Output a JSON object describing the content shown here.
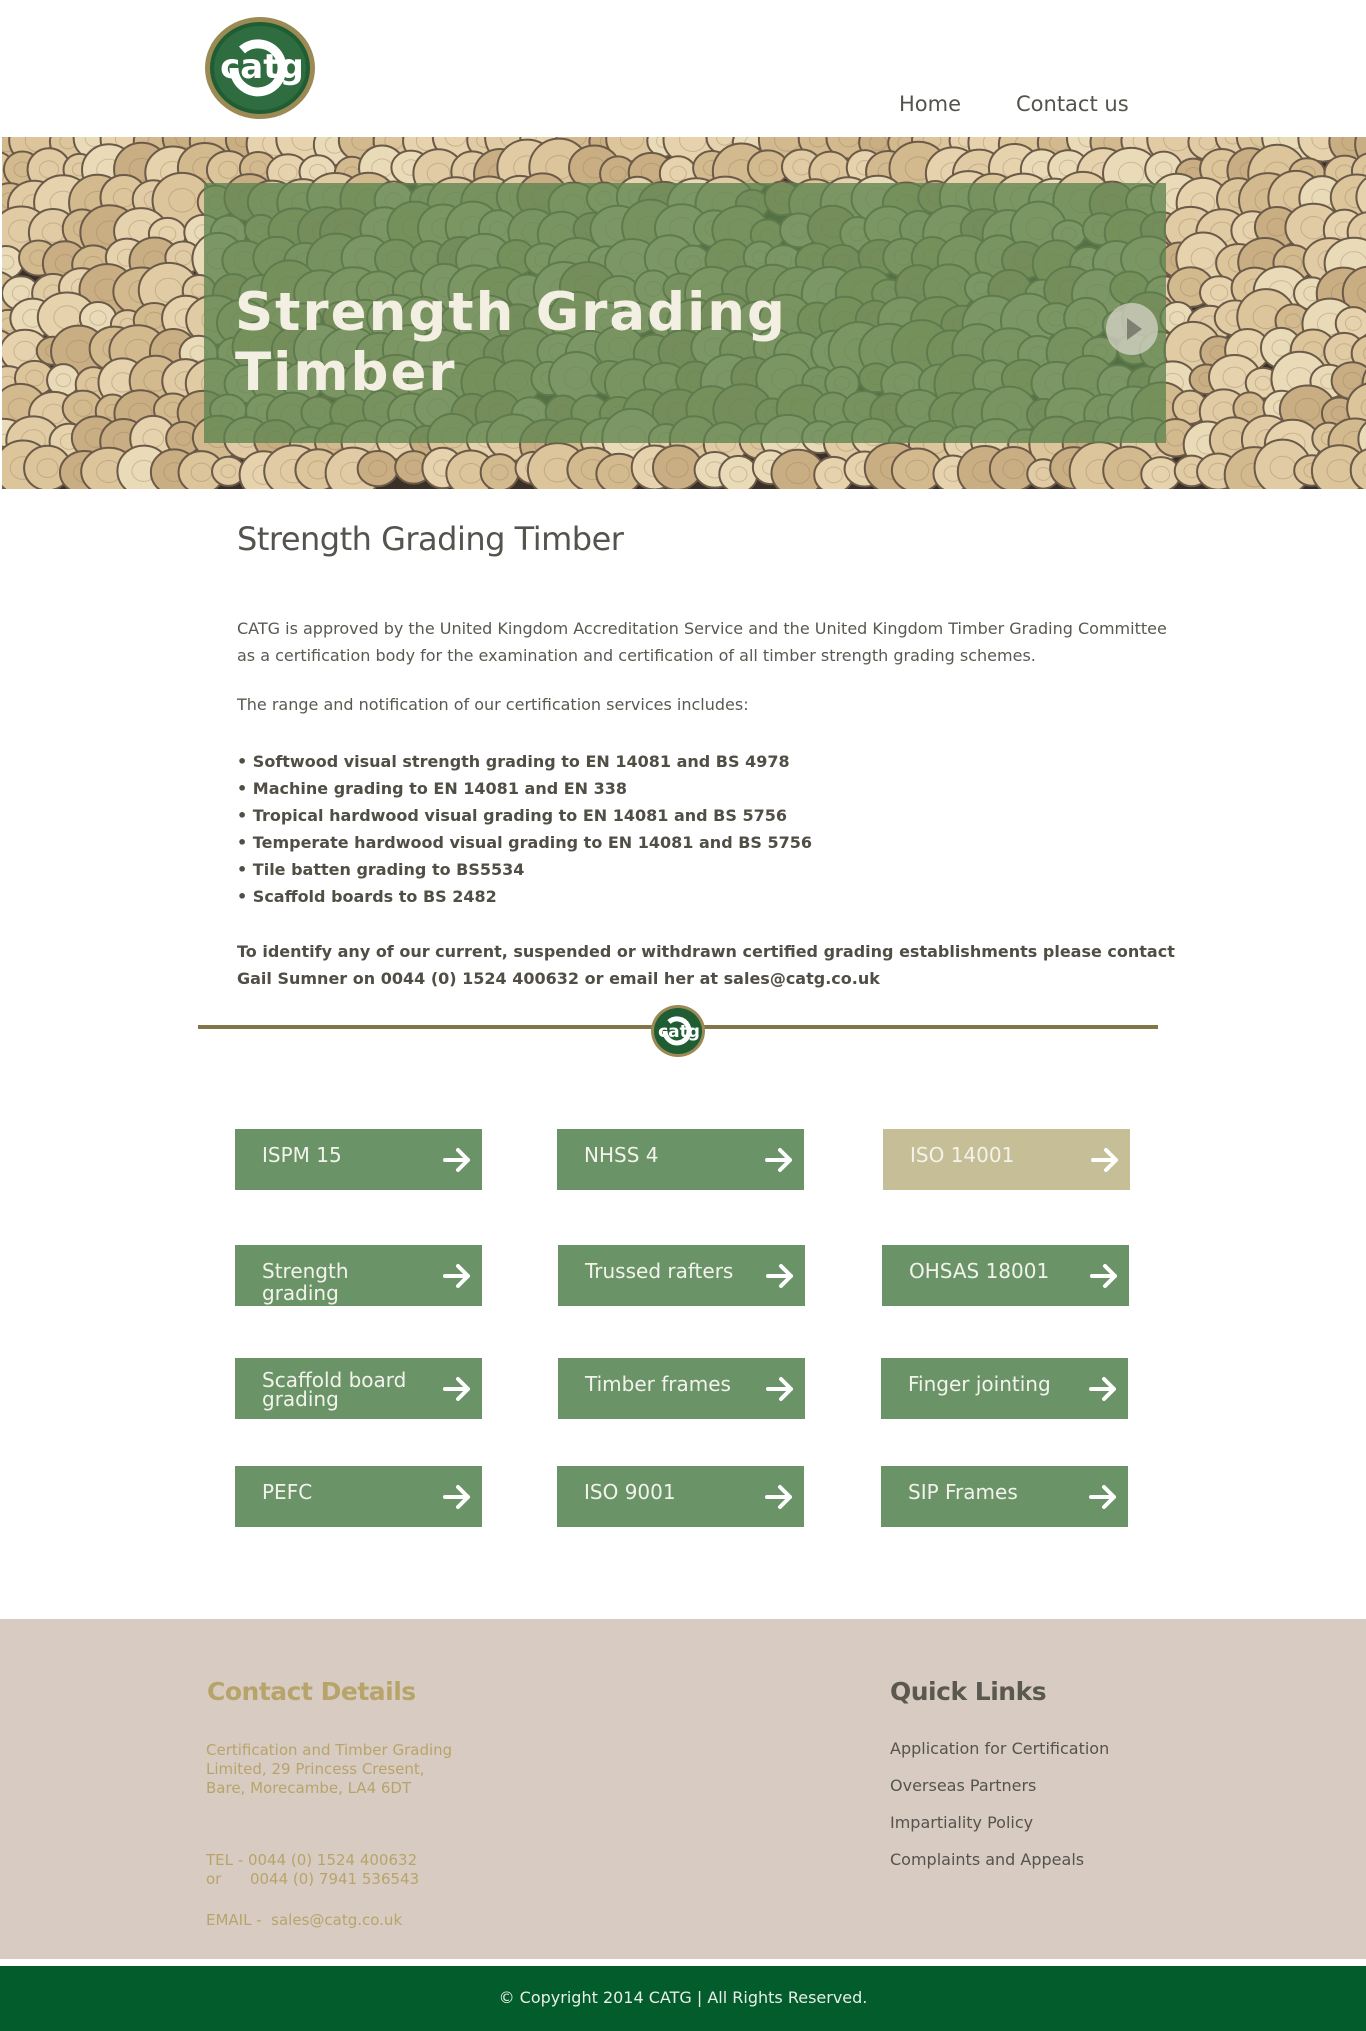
{
  "header": {
    "logo_text": "catg",
    "nav": {
      "home": "Home",
      "contact": "Contact us"
    }
  },
  "hero": {
    "title": "Strength Grading Timber"
  },
  "content": {
    "title": "Strength Grading Timber",
    "intro": "CATG is approved by the United Kingdom Accreditation Service and the United Kingdom Timber Grading Committee as a certification body for the examination and certification of all timber strength grading schemes.",
    "range": "The range and notification of our certification services includes:",
    "bullets": [
      "• Softwood visual strength grading to EN 14081 and BS 4978",
      "• Machine grading to EN 14081 and EN 338",
      "• Tropical hardwood visual grading to EN 14081 and BS 5756",
      "• Temperate hardwood visual grading to EN 14081 and BS 5756",
      "• Tile batten grading to BS5534",
      "•  Scaffold boards to BS 2482"
    ],
    "identify": "To identify any of our current, suspended or withdrawn certified grading establishments please contact Gail Sumner on 0044 (0) 1524 400632 or email her at sales@catg.co.uk"
  },
  "divider": {
    "logo_text": "catg"
  },
  "buttons": [
    {
      "label": "ISPM 15"
    },
    {
      "label": "NHSS 4"
    },
    {
      "label": "ISO 14001"
    },
    {
      "label": "Strength grading"
    },
    {
      "label": "Trussed rafters"
    },
    {
      "label": "OHSAS 18001"
    },
    {
      "label": "Scaffold board grading"
    },
    {
      "label": "Timber frames"
    },
    {
      "label": "Finger jointing"
    },
    {
      "label": "PEFC"
    },
    {
      "label": "ISO 9001"
    },
    {
      "label": "SIP Frames"
    }
  ],
  "footer": {
    "contact_title": "Contact Details",
    "address": "Certification and Timber Grading Limited, 29 Princess Cresent, Bare, Morecambe, LA4 6DT",
    "tel_line1": "TEL - 0044 (0) 1524 400632",
    "tel_line2": "or      0044 (0) 7941 536543",
    "email": "EMAIL -  sales@catg.co.uk",
    "quick_links_title": "Quick Links",
    "quick_links": [
      "Application for Certification",
      "Overseas Partners",
      "Impartiality Policy",
      "Complaints and Appeals"
    ],
    "copyright": "© Copyright 2014 CATG |  All Rights Reserved."
  },
  "colors": {
    "button_green": "#6a9468",
    "button_pale": "#c5be97",
    "divider": "#837549",
    "footer_bg": "#d8ccc2",
    "footer_gold": "#b7a46b",
    "copyright_bar": "#025c2c"
  },
  "icons": [
    "catg-logo",
    "play-icon",
    "arrow-right-icon"
  ]
}
